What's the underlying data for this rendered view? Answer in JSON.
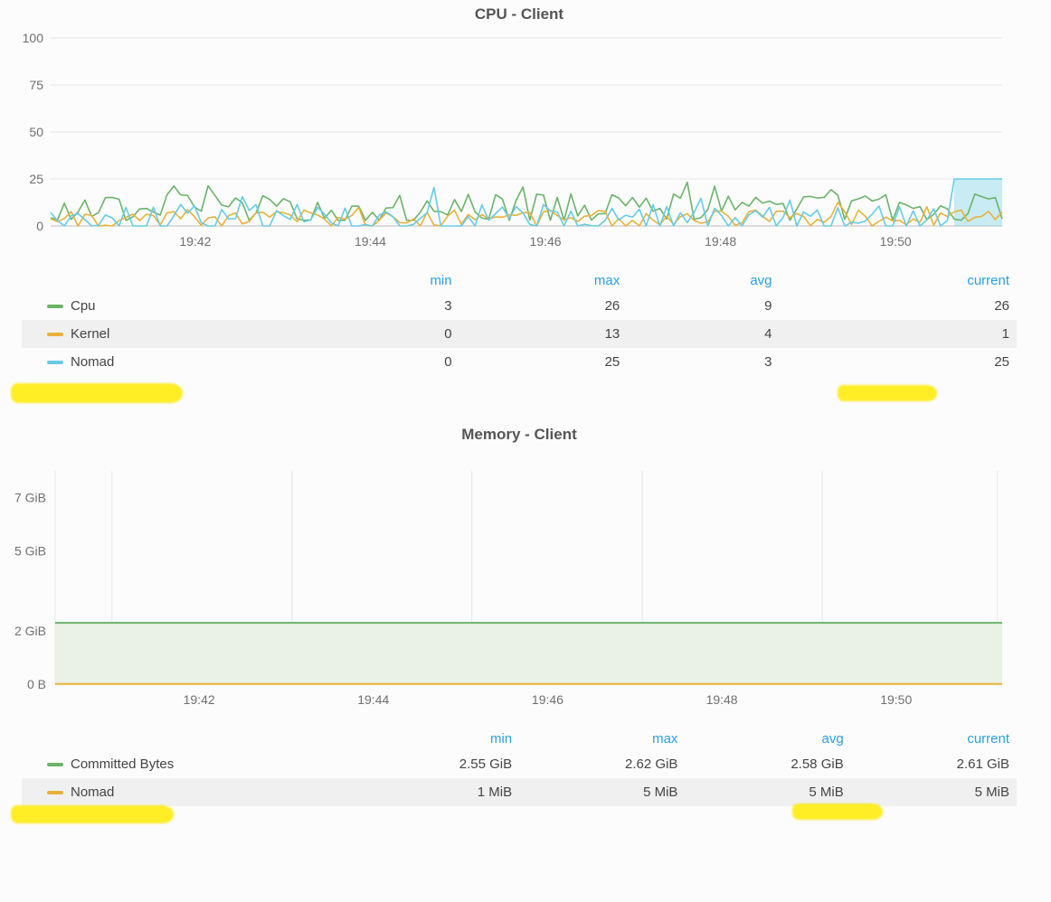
{
  "chart_data": [
    {
      "type": "line",
      "title": "CPU - Client",
      "ylabel": "",
      "y_ticks": [
        0,
        25,
        50,
        75,
        100
      ],
      "ylim": [
        0,
        100
      ],
      "x_ticks": [
        "19:42",
        "19:44",
        "19:46",
        "19:48",
        "19:50"
      ],
      "series": [
        {
          "name": "Cpu",
          "color": "#6bb36b",
          "min": 3,
          "max": 26,
          "avg": 9,
          "current": 26
        },
        {
          "name": "Kernel",
          "color": "#e8b13a",
          "min": 0,
          "max": 13,
          "avg": 4,
          "current": 1
        },
        {
          "name": "Nomad",
          "color": "#66cbe6",
          "min": 0,
          "max": 25,
          "avg": 3,
          "current": 25
        }
      ],
      "legend_headers": [
        "min",
        "max",
        "avg",
        "current"
      ]
    },
    {
      "type": "line",
      "title": "Memory - Client",
      "ylabel": "",
      "y_ticks": [
        "0 B",
        "2 GiB",
        "5 GiB",
        "7 GiB"
      ],
      "ylim": [
        0,
        8
      ],
      "x_ticks": [
        "19:42",
        "19:44",
        "19:46",
        "19:48",
        "19:50"
      ],
      "series": [
        {
          "name": "Committed Bytes",
          "color": "#6bb36b",
          "fill": "#e9f2e5",
          "min": "2.55 GiB",
          "max": "2.62 GiB",
          "avg": "2.58 GiB",
          "current": "2.61 GiB",
          "flat_value_gib": 2.3
        },
        {
          "name": "Nomad",
          "color": "#e8b13a",
          "min": "1 MiB",
          "max": "5 MiB",
          "avg": "5 MiB",
          "current": "5 MiB",
          "flat_value_gib": 0.01
        }
      ],
      "legend_headers": [
        "min",
        "max",
        "avg",
        "current"
      ]
    }
  ],
  "colors": {
    "accent_header": "#2aa0de",
    "highlight": "#ffe600"
  }
}
